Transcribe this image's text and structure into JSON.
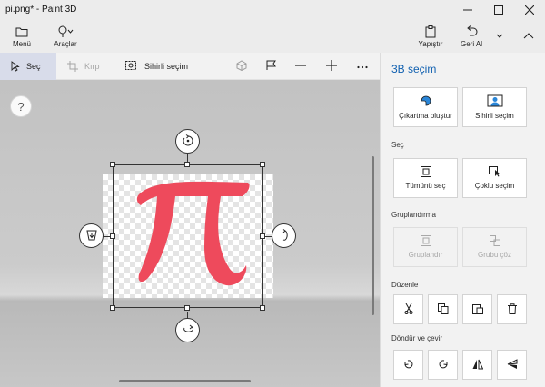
{
  "window": {
    "title": "pi.png* - Paint 3D"
  },
  "ribbon": {
    "menu_label": "Menü",
    "tools_label": "Araçlar",
    "paste_label": "Yapıştır",
    "undo_label": "Geri Al"
  },
  "toolbar": {
    "select_label": "Seç",
    "crop_label": "Kırp",
    "magic_select_label": "Sihirli seçim"
  },
  "canvas": {
    "help_label": "?",
    "image_glyph": "π",
    "image_color": "#ee4a5c"
  },
  "panel": {
    "title": "3B seçim",
    "cards": {
      "make_sticker": "Çıkartma oluştur",
      "magic_select": "Sihirli seçim"
    },
    "select_section": "Seç",
    "select_all": "Tümünü seç",
    "multi_select": "Çoklu seçim",
    "group_section": "Gruplandırma",
    "group": "Gruplandır",
    "ungroup": "Grubu çöz",
    "edit_section": "Düzenle",
    "rotate_section": "Döndür ve çevir"
  },
  "colors": {
    "accent": "#1060b0",
    "selected_tool_bg": "#d8dcea"
  }
}
